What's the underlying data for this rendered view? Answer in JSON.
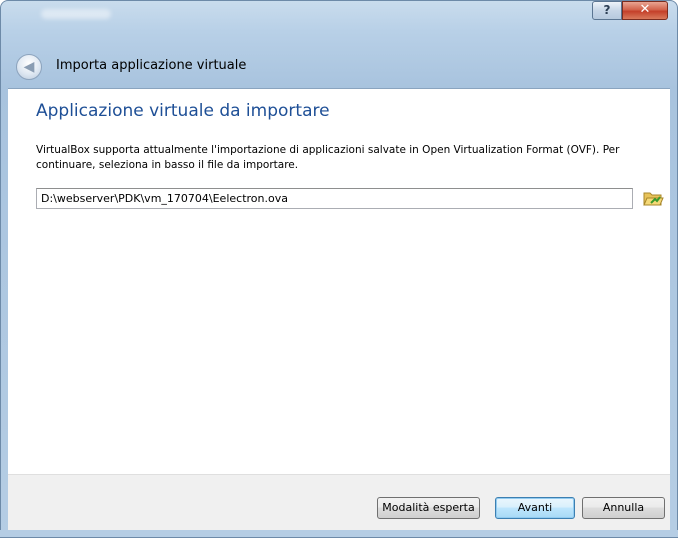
{
  "window": {
    "help_glyph": "?",
    "close_glyph": "✕"
  },
  "wizard": {
    "title": "Importa applicazione virtuale",
    "back_glyph": "◀"
  },
  "page": {
    "heading": "Applicazione virtuale da importare",
    "description": "VirtualBox supporta attualmente l'importazione di applicazioni salvate in Open Virtualization Format (OVF). Per continuare, seleziona in basso il file da importare.",
    "file_path": "D:\\webserver\\PDK\\vm_170704\\Eelectron.ova"
  },
  "buttons": {
    "expert": "Modalità esperta",
    "next": "Avanti",
    "cancel": "Annulla"
  },
  "colors": {
    "heading": "#1e4f96",
    "frame": "#b8d0e7",
    "close": "#c4402a"
  },
  "icons": {
    "folder": "open-folder-icon",
    "back": "back-arrow-icon"
  }
}
